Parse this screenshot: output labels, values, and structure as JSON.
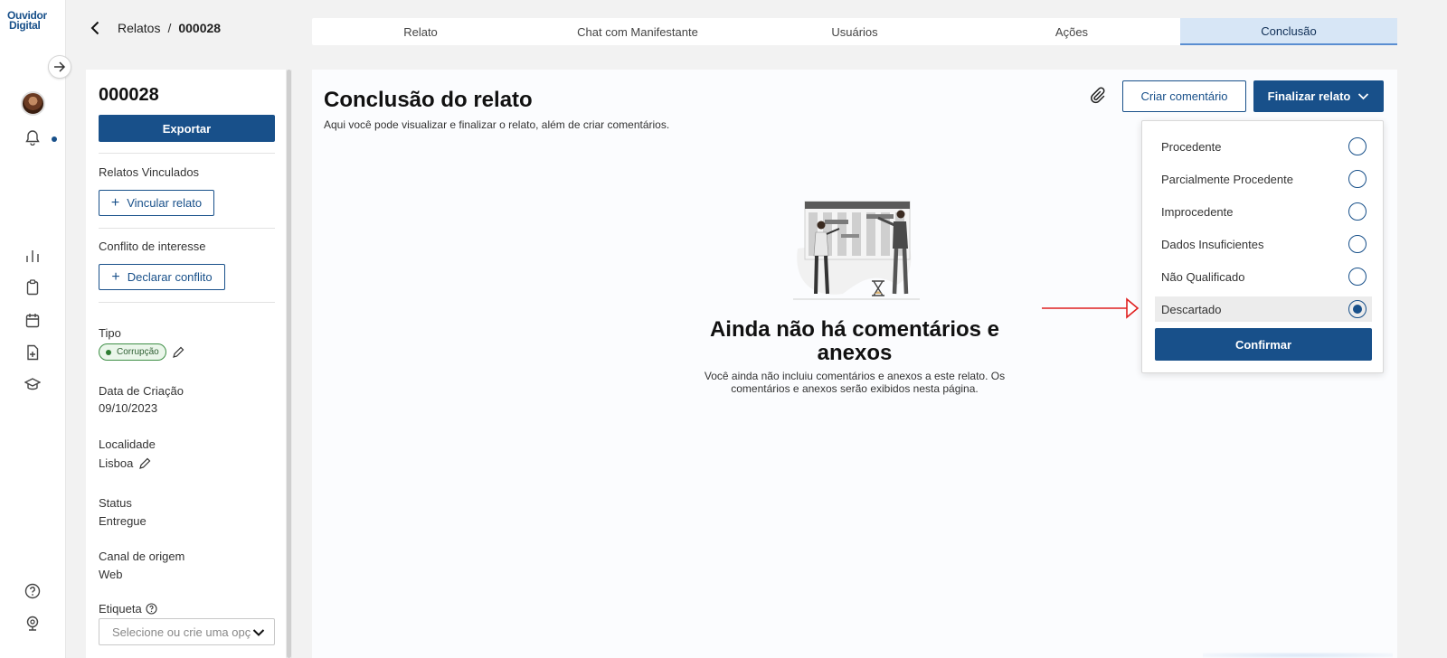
{
  "app": {
    "logo_line1": "Ouvidor",
    "logo_line2": "Digital"
  },
  "rail": {
    "icons": [
      "arrow-right-icon",
      "avatar",
      "bell-icon",
      "bar-chart-icon",
      "clipboard-icon",
      "calendar-icon",
      "file-add-icon",
      "graduation-cap-icon",
      "help-circle-icon",
      "webcam-icon"
    ],
    "accent": "#18508a"
  },
  "breadcrumb": {
    "parent": "Relatos",
    "separator": "/",
    "current": "000028"
  },
  "tabs": [
    {
      "label": "Relato"
    },
    {
      "label": "Chat com Manifestante"
    },
    {
      "label": "Usuários"
    },
    {
      "label": "Ações"
    },
    {
      "label": "Conclusão",
      "active": true
    }
  ],
  "side": {
    "report_id": "000028",
    "export_label": "Exportar",
    "linked_title": "Relatos Vinculados",
    "link_button": "Vincular relato",
    "conflict_title": "Conflito de interesse",
    "conflict_button": "Declarar conflito",
    "fields": {
      "tipo_label": "Tipo",
      "tipo_value": "Corrupção",
      "data_label": "Data de Criação",
      "data_value": "09/10/2023",
      "local_label": "Localidade",
      "local_value": "Lisboa",
      "status_label": "Status",
      "status_value": "Entregue",
      "canal_label": "Canal de origem",
      "canal_value": "Web",
      "etiqueta_label": "Etiqueta"
    },
    "etiqueta_placeholder": "Selecione ou crie uma opç"
  },
  "main": {
    "title": "Conclusão do relato",
    "subtitle": "Aqui você pode visualizar e finalizar o relato, além de criar comentários.",
    "create_comment": "Criar comentário",
    "finalize": "Finalizar relato",
    "empty_title": "Ainda não há comentários e anexos",
    "empty_desc": "Você ainda não incluiu comentários e anexos a este relato. Os comentários e anexos serão exibidos nesta página."
  },
  "dropdown": {
    "options": [
      {
        "label": "Procedente",
        "selected": false
      },
      {
        "label": "Parcialmente Procedente",
        "selected": false
      },
      {
        "label": "Improcedente",
        "selected": false
      },
      {
        "label": "Dados Insuficientes",
        "selected": false
      },
      {
        "label": "Não Qualificado",
        "selected": false
      },
      {
        "label": "Descartado",
        "selected": true
      }
    ],
    "confirm": "Confirmar"
  },
  "colors": {
    "primary": "#18508a",
    "tab_active_bg": "#d7e6f6",
    "annotation_arrow": "#e02020",
    "tag_green": "#2e7d32"
  }
}
